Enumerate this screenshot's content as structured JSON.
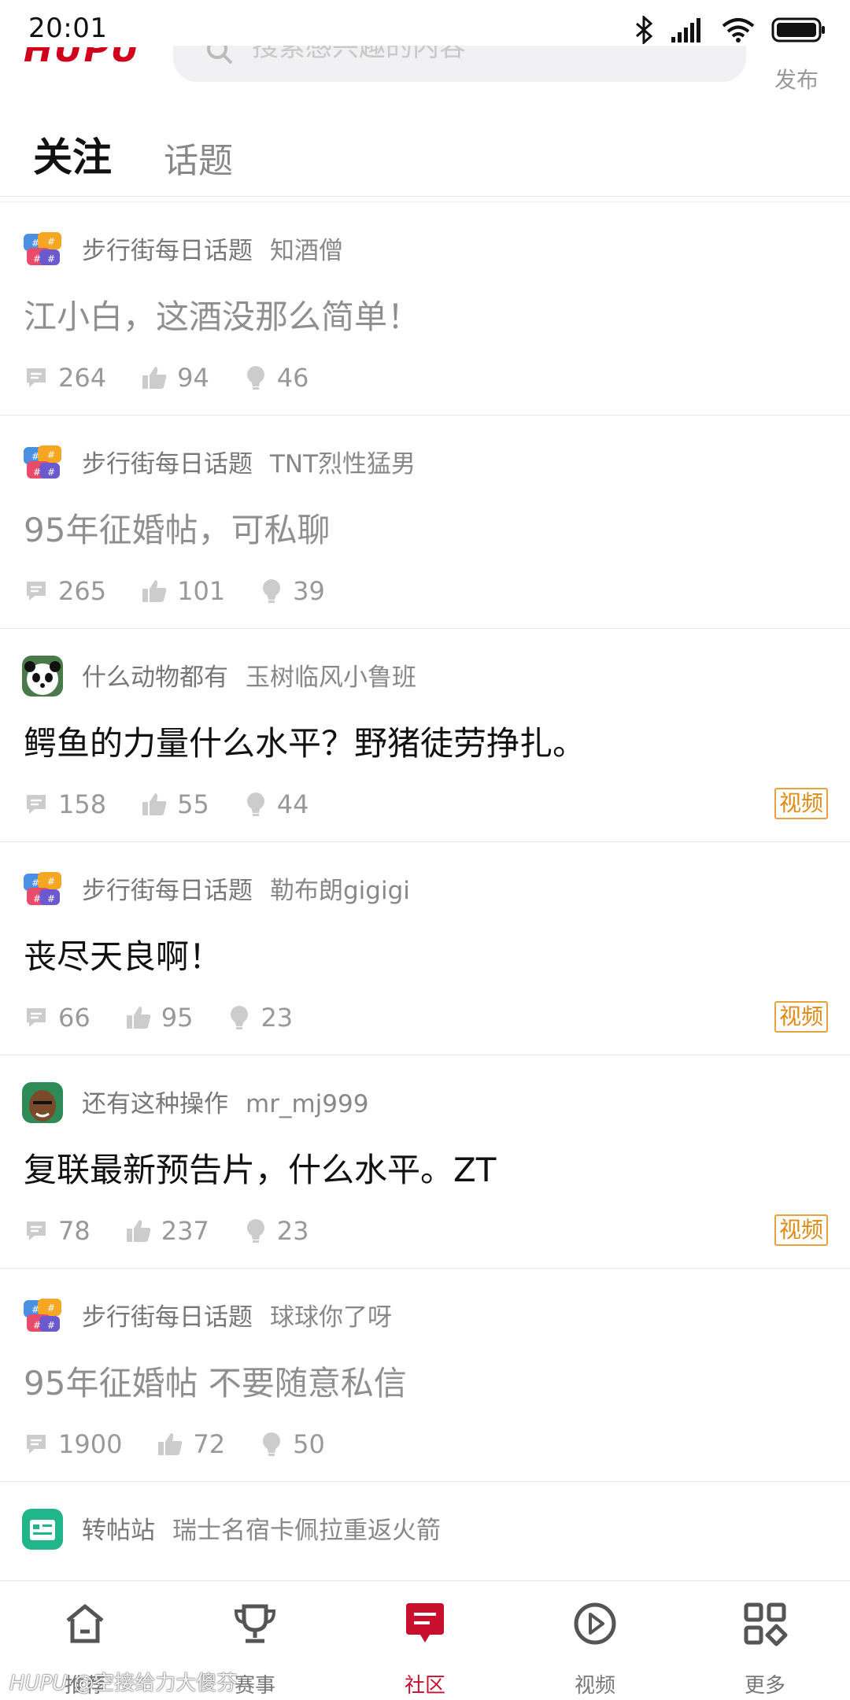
{
  "status_bar": {
    "time": "20:01",
    "icons": [
      "bluetooth-icon",
      "signal-icon",
      "wifi-icon",
      "battery-icon"
    ]
  },
  "header": {
    "logo": "HUPU",
    "search_placeholder": "搜索感兴趣的内容",
    "publish": "发布"
  },
  "tabs": [
    {
      "label": "关注",
      "active": true
    },
    {
      "label": "话题",
      "active": false
    }
  ],
  "posts": [
    {
      "forum": "步行街每日话题",
      "author": "知酒僧",
      "title": "江小白，这酒没那么简单！",
      "read": true,
      "replies": "264",
      "likes": "94",
      "lights": "46",
      "tag": "",
      "avatar": "topic"
    },
    {
      "forum": "步行街每日话题",
      "author": "TNT烈性猛男",
      "title": "95年征婚帖，可私聊",
      "read": true,
      "replies": "265",
      "likes": "101",
      "lights": "39",
      "tag": "",
      "avatar": "topic"
    },
    {
      "forum": "什么动物都有",
      "author": "玉树临风小鲁班",
      "title": "鳄鱼的力量什么水平？野猪徒劳挣扎。",
      "read": false,
      "replies": "158",
      "likes": "55",
      "lights": "44",
      "tag": "视频",
      "avatar": "panda"
    },
    {
      "forum": "步行街每日话题",
      "author": "勒布朗gigigi",
      "title": "丧尽天良啊！",
      "read": false,
      "replies": "66",
      "likes": "95",
      "lights": "23",
      "tag": "视频",
      "avatar": "topic"
    },
    {
      "forum": "还有这种操作",
      "author": "mr_mj999",
      "title": "复联最新预告片，什么水平。ZT",
      "read": false,
      "replies": "78",
      "likes": "237",
      "lights": "23",
      "tag": "视频",
      "avatar": "face"
    },
    {
      "forum": "步行街每日话题",
      "author": "球球你了呀",
      "title": "95年征婚帖 不要随意私信",
      "read": true,
      "replies": "1900",
      "likes": "72",
      "lights": "50",
      "tag": "",
      "avatar": "topic"
    },
    {
      "forum": "转帖站",
      "author": "瑞士名宿卡佩拉重返火箭",
      "title": "",
      "read": false,
      "replies": "",
      "likes": "",
      "lights": "",
      "tag": "",
      "avatar": "repost"
    }
  ],
  "bottom_nav": [
    {
      "label": "推荐",
      "icon": "home-icon",
      "active": false
    },
    {
      "label": "赛事",
      "icon": "trophy-icon",
      "active": false
    },
    {
      "label": "社区",
      "icon": "community-icon",
      "active": true
    },
    {
      "label": "视频",
      "icon": "play-icon",
      "active": false
    },
    {
      "label": "更多",
      "icon": "grid-icon",
      "active": false
    }
  ],
  "watermark": {
    "brand": "HUPU",
    "user": "@空接给力大傻芬"
  },
  "colors": {
    "brand_red": "#c8102e",
    "video_tag": "#e08a14",
    "read_title": "#8f8f8f",
    "meta": "#999999"
  }
}
